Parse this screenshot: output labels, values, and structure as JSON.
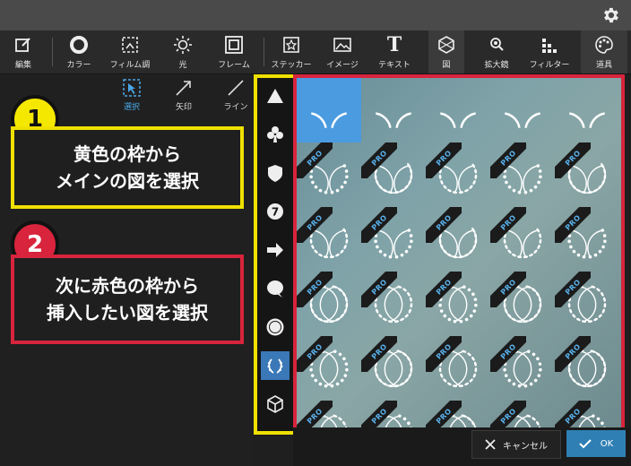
{
  "toolbar": {
    "items": [
      {
        "label": "編集",
        "icon": "edit-icon"
      },
      {
        "label": "カラー",
        "icon": "color-icon"
      },
      {
        "label": "フィルム調",
        "icon": "film-icon"
      },
      {
        "label": "光",
        "icon": "light-icon"
      },
      {
        "label": "フレーム",
        "icon": "frame-icon"
      },
      {
        "label": "ステッカー",
        "icon": "sticker-icon"
      },
      {
        "label": "イメージ",
        "icon": "image-icon"
      },
      {
        "label": "テキスト",
        "icon": "text-icon"
      },
      {
        "label": "図",
        "icon": "shape-icon"
      },
      {
        "label": "拡大鏡",
        "icon": "magnifier-icon"
      },
      {
        "label": "フィルター",
        "icon": "filter-icon"
      },
      {
        "label": "道具",
        "icon": "palette-icon"
      }
    ]
  },
  "subtools": {
    "select": "選択",
    "arrow": "矢印",
    "line": "ライン"
  },
  "callouts": {
    "num1": "1",
    "box1_line1": "黄色の枠から",
    "box1_line2": "メインの図を選択",
    "num2": "2",
    "box2_line1": "次に赤色の枠から",
    "box2_line2": "挿入したい図を選択"
  },
  "shape_categories": [
    "triangle-icon",
    "club-icon",
    "shield-icon",
    "number-badge-icon",
    "arrow-right-icon",
    "speech-bubble-icon",
    "seal-icon",
    "laurel-icon",
    "cube-icon"
  ],
  "shape_badge_number": "7",
  "pro_label": "PRO",
  "actions": {
    "cancel": "キャンセル",
    "ok": "OK"
  },
  "colors": {
    "accent_blue": "#2f7fb4",
    "callout_yellow": "#f0e000",
    "callout_red": "#d8243c",
    "pro_text": "#5ab4f0"
  }
}
